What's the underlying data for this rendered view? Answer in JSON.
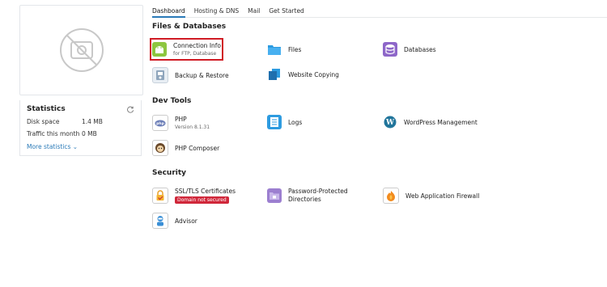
{
  "tabs": [
    "Dashboard",
    "Hosting & DNS",
    "Mail",
    "Get Started"
  ],
  "statistics": {
    "title": "Statistics",
    "disk_label": "Disk space",
    "disk_value": "1.4 MB",
    "traffic_label": "Traffic this month",
    "traffic_value": "0 MB",
    "more": "More statistics ⌄"
  },
  "sections": {
    "files": "Files & Databases",
    "dev": "Dev Tools",
    "security": "Security"
  },
  "tiles": {
    "connection": {
      "label": "Connection Info",
      "sub": "for FTP, Database"
    },
    "files": {
      "label": "Files"
    },
    "databases": {
      "label": "Databases"
    },
    "backup": {
      "label": "Backup & Restore"
    },
    "copying": {
      "label": "Website Copying"
    },
    "php": {
      "label": "PHP",
      "sub": "Version 8.1.31"
    },
    "logs": {
      "label": "Logs"
    },
    "wordpress": {
      "label": "WordPress Management"
    },
    "composer": {
      "label": "PHP Composer"
    },
    "ssl": {
      "label": "SSL/TLS Certificates",
      "badge": "Domain not secured"
    },
    "password": {
      "label": "Password-Protected Directories"
    },
    "firewall": {
      "label": "Web Application Firewall"
    },
    "advisor": {
      "label": "Advisor"
    }
  },
  "colors": {
    "accent": "#2a7ab8",
    "highlight": "#d01b24",
    "badge": "#d0273a"
  }
}
